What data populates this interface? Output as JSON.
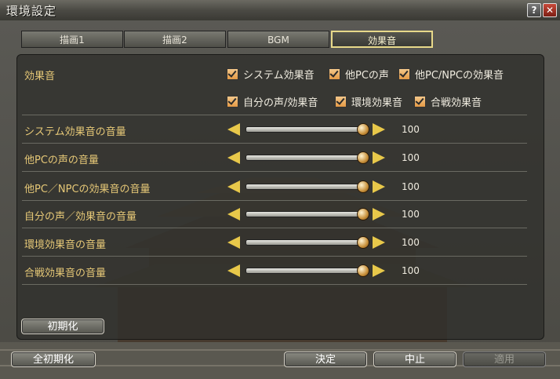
{
  "window": {
    "title": "環境設定",
    "help_icon": "?",
    "close_icon": "✕"
  },
  "tabs": [
    {
      "label": "描画1"
    },
    {
      "label": "描画2"
    },
    {
      "label": "BGM"
    },
    {
      "label": "効果音",
      "active": true
    }
  ],
  "sound_effects": {
    "label": "効果音",
    "checkboxes": [
      {
        "label": "システム効果音",
        "checked": true
      },
      {
        "label": "他PCの声",
        "checked": true
      },
      {
        "label": "他PC/NPCの効果音",
        "checked": true
      },
      {
        "label": "自分の声/効果音",
        "checked": true
      },
      {
        "label": "環境効果音",
        "checked": true
      },
      {
        "label": "合戦効果音",
        "checked": true
      }
    ]
  },
  "volume_rows": [
    {
      "label": "システム効果音の音量",
      "value": "100"
    },
    {
      "label": "他PCの声の音量",
      "value": "100"
    },
    {
      "label": "他PC／NPCの効果音の音量",
      "value": "100"
    },
    {
      "label": "自分の声／効果音の音量",
      "value": "100"
    },
    {
      "label": "環境効果音の音量",
      "value": "100"
    },
    {
      "label": "合戦効果音の音量",
      "value": "100"
    }
  ],
  "buttons": {
    "reset": "初期化",
    "reset_all": "全初期化",
    "ok": "決定",
    "cancel": "中止",
    "apply": "適用"
  },
  "colors": {
    "label_gold": "#e6c877",
    "arrow": "#e8c84a",
    "checkbox": "#e69a45",
    "active_tab_border": "#e8d98a"
  }
}
